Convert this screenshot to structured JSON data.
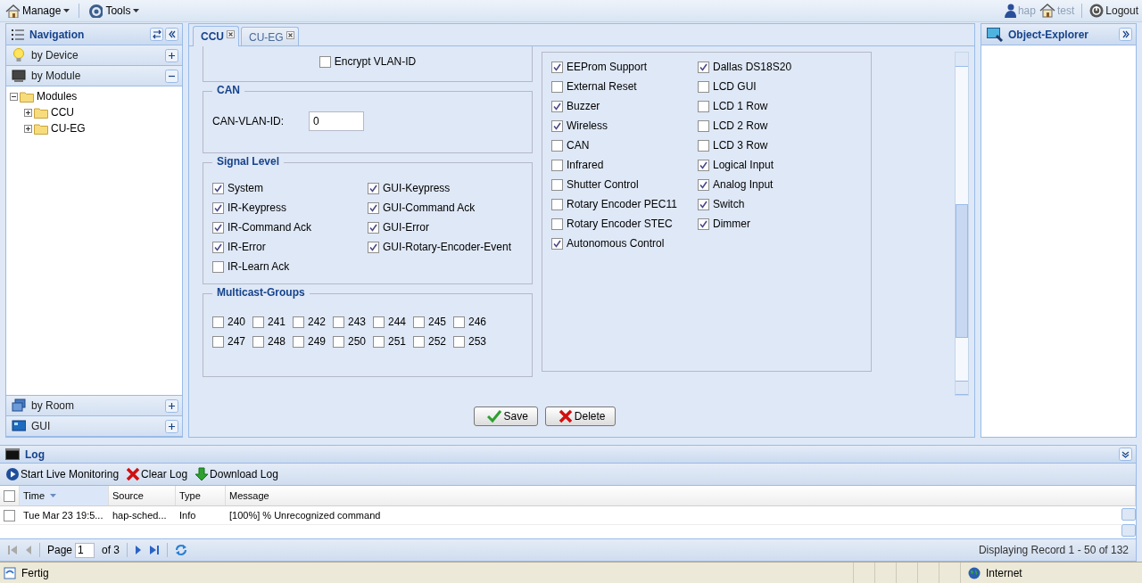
{
  "toolbar": {
    "menus": [
      {
        "label": "Manage",
        "kind": "manage"
      },
      {
        "label": "Tools",
        "kind": "tools"
      }
    ],
    "user": "hap",
    "location": "test",
    "logout": "Logout"
  },
  "navigation": {
    "title": "Navigation",
    "sections_top": [
      {
        "label": "by Device",
        "kind": "device",
        "expanded": false
      },
      {
        "label": "by Module",
        "kind": "module",
        "expanded": true
      }
    ],
    "tree": [
      {
        "label": "Modules",
        "expanded": true,
        "children": [
          {
            "label": "CCU",
            "expanded": false
          },
          {
            "label": "CU-EG",
            "expanded": false
          }
        ]
      }
    ],
    "sections_bottom": [
      {
        "label": "by Room",
        "kind": "room",
        "expanded": false
      },
      {
        "label": "GUI",
        "kind": "gui",
        "expanded": false
      }
    ]
  },
  "tabs": [
    {
      "label": "CCU",
      "selected": true
    },
    {
      "label": "CU-EG",
      "selected": false
    }
  ],
  "form": {
    "encrypt": {
      "label": "Encrypt VLAN-ID",
      "checked": false
    },
    "can": {
      "legend": "CAN",
      "field_label": "CAN-VLAN-ID:",
      "value": "0"
    },
    "signal_level": {
      "legend": "Signal Level",
      "columns": [
        [
          {
            "label": "System",
            "checked": true
          },
          {
            "label": "IR-Keypress",
            "checked": true
          },
          {
            "label": "IR-Command Ack",
            "checked": true
          },
          {
            "label": "IR-Error",
            "checked": true
          },
          {
            "label": "IR-Learn Ack",
            "checked": false
          }
        ],
        [
          {
            "label": "GUI-Keypress",
            "checked": true
          },
          {
            "label": "GUI-Command Ack",
            "checked": true
          },
          {
            "label": "GUI-Error",
            "checked": true
          },
          {
            "label": "GUI-Rotary-Encoder-Event",
            "checked": true
          }
        ]
      ]
    },
    "multicast": {
      "legend": "Multicast-Groups",
      "options": [
        {
          "label": "240",
          "checked": false
        },
        {
          "label": "241",
          "checked": false
        },
        {
          "label": "242",
          "checked": false
        },
        {
          "label": "243",
          "checked": false
        },
        {
          "label": "244",
          "checked": false
        },
        {
          "label": "245",
          "checked": false
        },
        {
          "label": "246",
          "checked": false
        },
        {
          "label": "247",
          "checked": false
        },
        {
          "label": "248",
          "checked": false
        },
        {
          "label": "249",
          "checked": false
        },
        {
          "label": "250",
          "checked": false
        },
        {
          "label": "251",
          "checked": false
        },
        {
          "label": "252",
          "checked": false
        },
        {
          "label": "253",
          "checked": false
        }
      ]
    },
    "features": {
      "columns": [
        [
          {
            "label": "EEProm Support",
            "checked": true
          },
          {
            "label": "External Reset",
            "checked": false
          },
          {
            "label": "Buzzer",
            "checked": true
          },
          {
            "label": "Wireless",
            "checked": true
          },
          {
            "label": "CAN",
            "checked": false
          },
          {
            "label": "Infrared",
            "checked": false
          },
          {
            "label": "Shutter Control",
            "checked": false
          },
          {
            "label": "Rotary Encoder PEC11",
            "checked": false
          },
          {
            "label": "Rotary Encoder STEC",
            "checked": false
          },
          {
            "label": "Autonomous Control",
            "checked": true
          }
        ],
        [
          {
            "label": "Dallas DS18S20",
            "checked": true
          },
          {
            "label": "LCD GUI",
            "checked": false
          },
          {
            "label": "LCD 1 Row",
            "checked": false
          },
          {
            "label": "LCD 2 Row",
            "checked": false
          },
          {
            "label": "LCD 3 Row",
            "checked": false
          },
          {
            "label": "Logical Input",
            "checked": true
          },
          {
            "label": "Analog Input",
            "checked": true
          },
          {
            "label": "Switch",
            "checked": true
          },
          {
            "label": "Dimmer",
            "checked": true
          }
        ]
      ]
    },
    "buttons": [
      {
        "label": "Save",
        "kind": "save"
      },
      {
        "label": "Delete",
        "kind": "delete"
      }
    ]
  },
  "object_explorer": {
    "title": "Object-Explorer"
  },
  "log": {
    "title": "Log",
    "actions": [
      {
        "label": "Start Live Monitoring",
        "kind": "play"
      },
      {
        "label": "Clear Log",
        "kind": "clear"
      },
      {
        "label": "Download Log",
        "kind": "download"
      }
    ],
    "columns": [
      {
        "label": "Time",
        "sorted": true
      },
      {
        "label": "Source",
        "sorted": false
      },
      {
        "label": "Type",
        "sorted": false
      },
      {
        "label": "Message",
        "sorted": false
      }
    ],
    "all_checked": false,
    "rows": [
      {
        "checked": false,
        "cells": [
          "Tue Mar 23 19:5...",
          "hap-sched...",
          "Info",
          "[100%] % Unrecognized command"
        ]
      }
    ],
    "pager": {
      "label": "Page",
      "page": "1",
      "of": "of 3",
      "summary": "Displaying Record 1 - 50 of 132"
    }
  },
  "status_bar": {
    "text": "Fertig",
    "zone": "Internet"
  }
}
